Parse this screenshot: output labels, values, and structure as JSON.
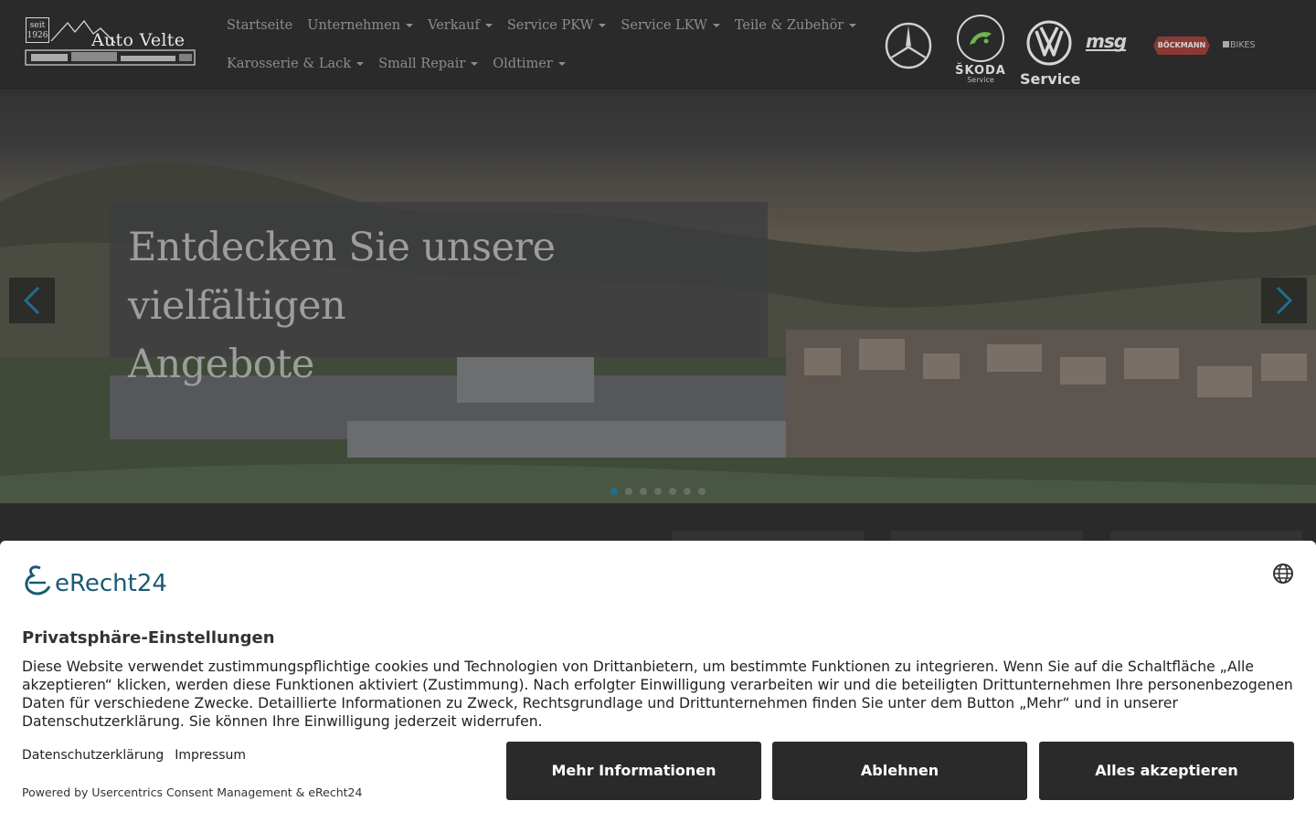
{
  "header": {
    "logo": {
      "badge_line1": "seit",
      "badge_line2": "1926",
      "name": "Auto Velte"
    },
    "nav_row1": [
      {
        "label": "Startseite",
        "dropdown": false
      },
      {
        "label": "Unternehmen",
        "dropdown": true
      },
      {
        "label": "Verkauf",
        "dropdown": true
      },
      {
        "label": "Service PKW",
        "dropdown": true
      },
      {
        "label": "Service LKW",
        "dropdown": true
      },
      {
        "label": "Teile & Zubehör",
        "dropdown": true
      }
    ],
    "nav_row2": [
      {
        "label": "Karosserie & Lack",
        "dropdown": true
      },
      {
        "label": "Small Repair",
        "dropdown": true
      },
      {
        "label": "Oldtimer",
        "dropdown": true
      }
    ],
    "brands": {
      "skoda": {
        "name": "ŠKODA",
        "sub": "Service"
      },
      "vw": {
        "sub": "Service"
      },
      "msg": "msg",
      "boeckmann": "BÖCKMANN",
      "bikes": "BIKES"
    }
  },
  "hero": {
    "title_line1": "Entdecken Sie unsere vielfältigen",
    "title_line2": "Angebote",
    "slide_count": 7,
    "active_slide": 1
  },
  "consent": {
    "brand": "eRecht24",
    "title": "Privatsphäre-Einstellungen",
    "body": "Diese Website verwendet zustimmungspflichtige cookies und Technologien von Drittanbietern, um bestimmte Funktionen zu integrieren. Wenn Sie auf die Schaltfläche „Alle akzeptieren“ klicken, werden diese Funktionen aktiviert (Zustimmung). Nach erfolgter Einwilligung verarbeiten wir und die beteiligten Drittunternehmen Ihre personenbezogenen Daten für verschiedene Zwecke. Detaillierte Informationen zu Zweck, Rechtsgrundlage und Drittunternehmen finden Sie unter dem Button „Mehr“ und in unserer Datenschutzerklärung. Sie können Ihre Einwilligung jederzeit widerrufen.",
    "links": {
      "privacy": "Datenschutzerklärung",
      "imprint": "Impressum"
    },
    "powered_by": "Powered by Usercentrics Consent Management & eRecht24",
    "buttons": {
      "more": "Mehr Informationen",
      "decline": "Ablehnen",
      "accept": "Alles akzeptieren"
    }
  },
  "colors": {
    "header_bg": "#2a2a2b",
    "consent_button_bg": "#2a2a2b",
    "erecht_brand": "#1a5a73",
    "active_dot": "#1e6f8e"
  }
}
